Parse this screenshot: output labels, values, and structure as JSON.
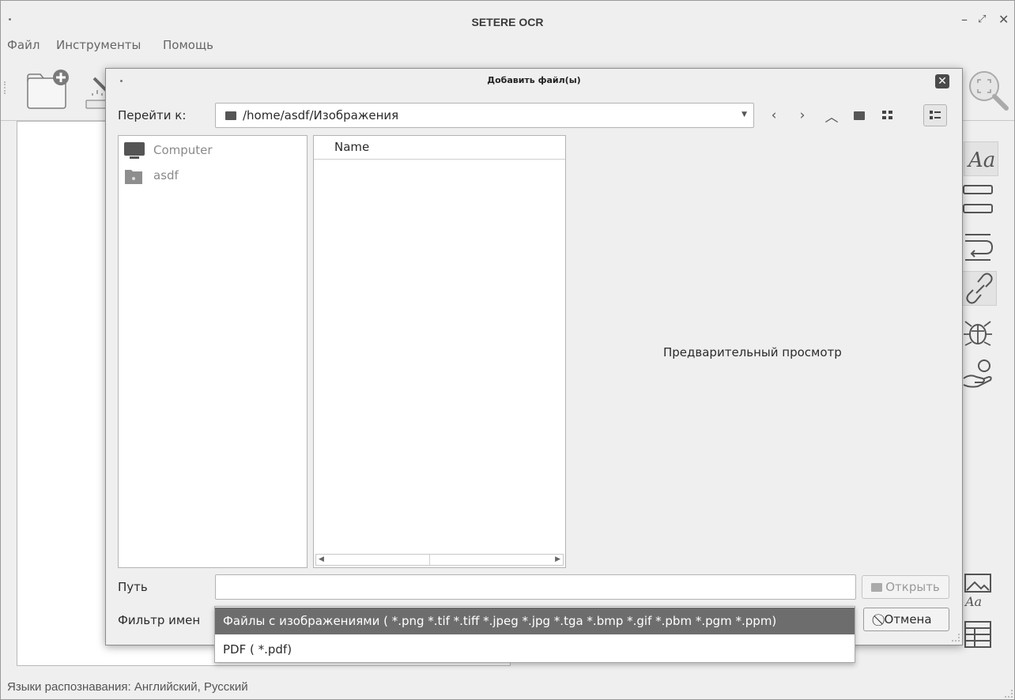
{
  "window": {
    "title": "SETERE OCR",
    "minimize": "–",
    "maximize": "⤢",
    "close": "✕"
  },
  "menu": {
    "file": "Файл",
    "tools": "Инструменты",
    "help": "Помощь"
  },
  "status": {
    "text": "Языки распознавания: Английский, Русский"
  },
  "dialog": {
    "title": "Добавить файл(ы)",
    "goto_label": "Перейти к:",
    "goto_path": "/home/asdf/Изображения",
    "places": [
      {
        "label": "Computer",
        "icon": "computer-icon"
      },
      {
        "label": "asdf",
        "icon": "home-folder-icon"
      }
    ],
    "file_list": {
      "column_name": "Name"
    },
    "preview_label": "Предварительный просмотр",
    "path_label": "Путь",
    "path_value": "",
    "filter_label": "Фильтр имен",
    "open_button": "Открыть",
    "cancel_button": "Отмена",
    "filter_options": [
      {
        "label": "Файлы с изображениями ( *.png *.tif *.tiff *.jpeg *.jpg *.tga *.bmp *.gif *.pbm *.pgm *.ppm)",
        "selected": true
      },
      {
        "label": "PDF ( *.pdf)",
        "selected": false
      }
    ]
  },
  "side_panel": {
    "icons": [
      "font-aa-icon",
      "text-block-icon",
      "wrap-text-icon",
      "link-icon",
      "bug-icon",
      "donate-hand-icon",
      "image-text-icon",
      "table-icon"
    ]
  },
  "colors": {
    "selected_option_bg": "#6d6d6d",
    "window_bg": "#efefef"
  }
}
